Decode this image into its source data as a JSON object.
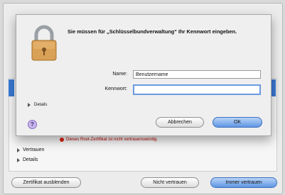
{
  "dialog": {
    "title": "Sie müssen für „Schlüsselbundverwaltung“ Ihr Kennwort eingeben.",
    "name_label": "Name:",
    "name_value": "Benutzername",
    "password_label": "Kennwort:",
    "password_value": "",
    "details_label": "Details",
    "help_glyph": "?",
    "cancel_label": "Abbrechen",
    "ok_label": "OK"
  },
  "background": {
    "warning_text": "Dieses Root-Zertifikat ist nicht vertrauenswürdig.",
    "trust_label": "Vertrauen",
    "details_label": "Details",
    "hide_cert_label": "Zertifikat ausblenden",
    "dont_trust_label": "Nicht vertrauen",
    "always_trust_label": "Immer vertrauen"
  },
  "icons": {
    "lock": "lock-icon",
    "help": "help-icon",
    "warning": "warning-icon"
  },
  "colors": {
    "accent": "#5f96e4",
    "warning": "#c00000"
  }
}
